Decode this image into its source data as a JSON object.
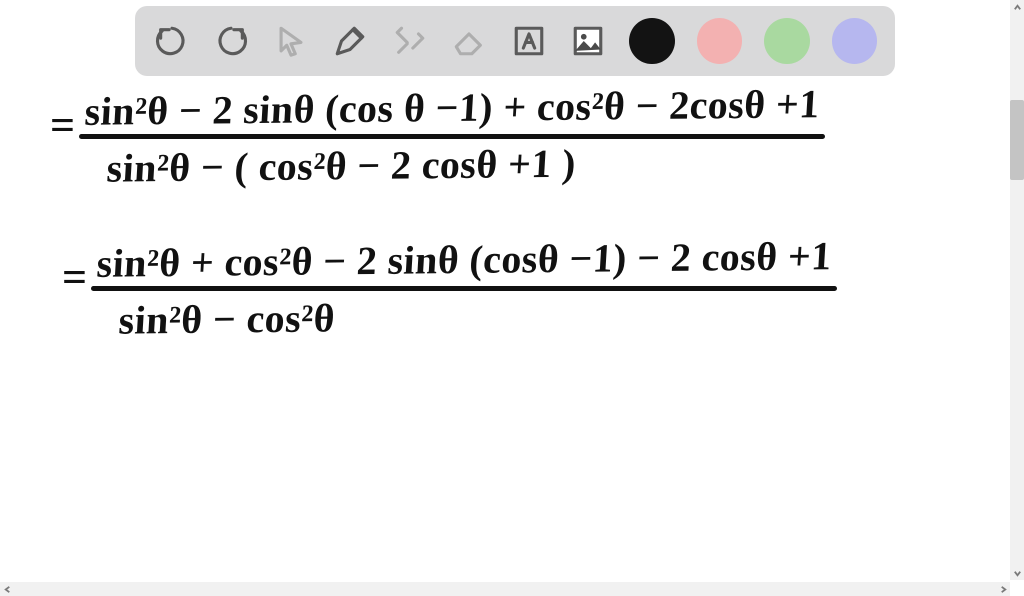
{
  "toolbar": {
    "undo_icon": "undo-icon",
    "redo_icon": "redo-icon",
    "cursor_icon": "cursor-icon",
    "pen_icon": "pen-icon",
    "tools_icon": "tools-icon",
    "eraser_icon": "eraser-icon",
    "text_icon": "text-icon",
    "image_icon": "image-icon",
    "colors": {
      "black": "#131313",
      "red": "#f3b1b1",
      "green": "#a9d9a0",
      "purple": "#b6b7ef"
    }
  },
  "equations": {
    "line1": {
      "numerator": "sin²θ − 2 sinθ (cos θ −1) + cos²θ − 2cosθ +1",
      "denominator": "sin²θ − ( cos²θ − 2 cosθ +1 )"
    },
    "line2": {
      "numerator": "sin²θ + cos²θ − 2 sinθ (cosθ −1) − 2 cosθ +1",
      "denominator": "sin²θ − cos²θ"
    }
  }
}
